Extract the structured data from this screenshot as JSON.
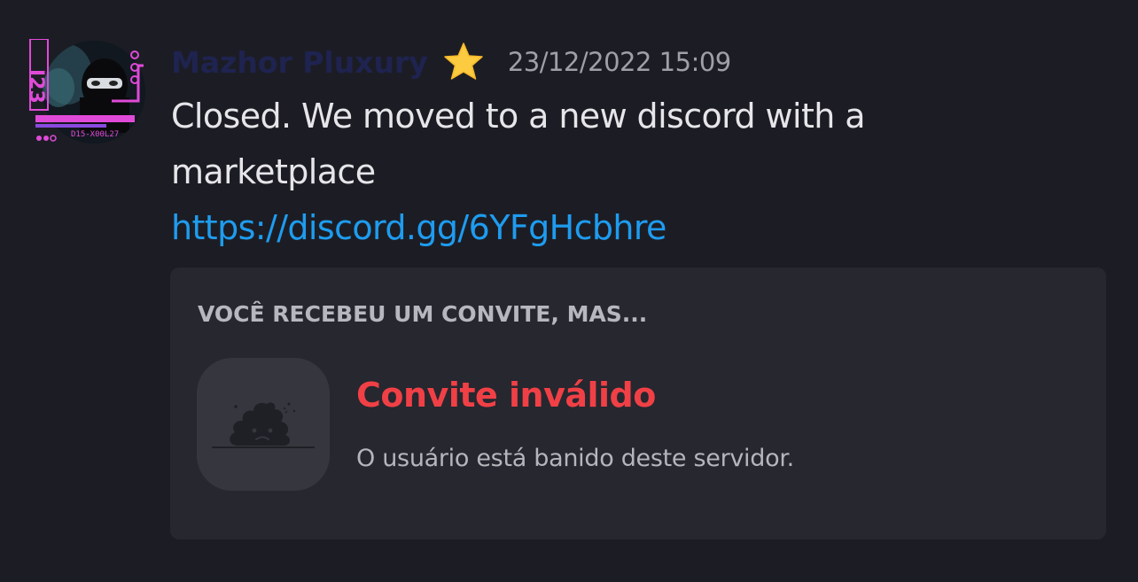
{
  "message": {
    "author": "Mazhor Pluxury",
    "author_badge": "star-emoji",
    "timestamp": "23/12/2022 15:09",
    "text_lines": [
      "Closed. We moved to a new discord with a",
      "marketplace"
    ],
    "link": "https://discord.gg/6YFgHcbhre"
  },
  "invite": {
    "heading": "VOCÊ RECEBEU UM CONVITE, MAS...",
    "title": "Convite inválido",
    "description": "O usuário está banido deste servidor.",
    "icon": "sad-poop-icon"
  },
  "colors": {
    "background": "#1c1d24",
    "card": "#26272f",
    "link": "#1e9cf0",
    "error": "#f04046",
    "username": "#1f2350"
  }
}
